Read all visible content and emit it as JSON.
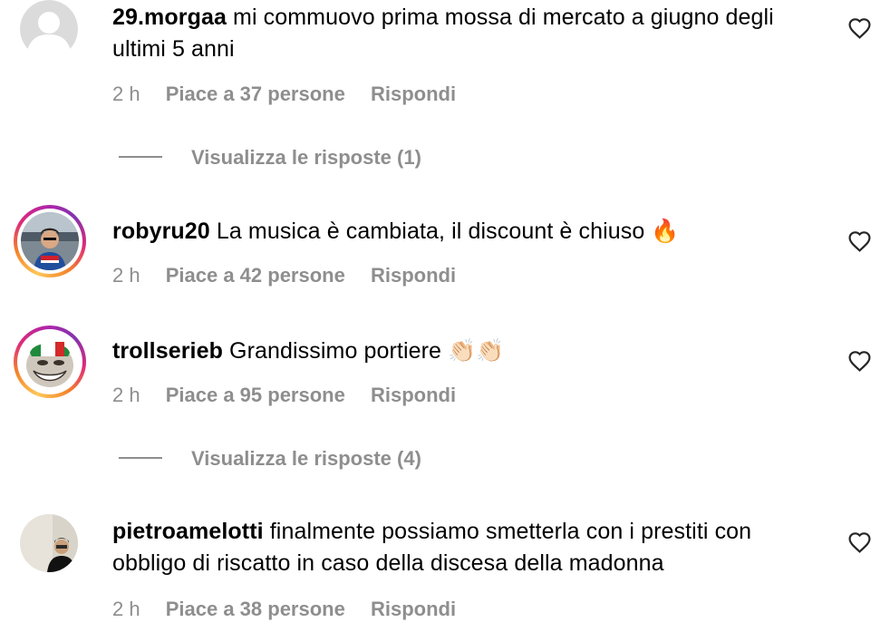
{
  "comments": [
    {
      "username": "29.morgaa",
      "text": "mi commuovo prima mossa di mercato a giugno degli ultimi 5 anni",
      "time": "2 h",
      "likes": "Piace a 37 persone",
      "reply": "Rispondi",
      "view_replies": "Visualizza le risposte (1)",
      "avatar": "default-avatar-icon"
    },
    {
      "username": "robyru20",
      "text": "La musica è cambiata, il discount è chiuso",
      "emoji": "🔥",
      "time": "2 h",
      "likes": "Piace a 42 persone",
      "reply": "Rispondi",
      "avatar": "user-photo-with-story-ring"
    },
    {
      "username": "trollserieb",
      "text": "Grandissimo portiere",
      "emoji": "👏🏻👏🏻",
      "time": "2 h",
      "likes": "Piace a 95 persone",
      "reply": "Rispondi",
      "view_replies": "Visualizza le risposte (4)",
      "avatar": "troll-face-with-story-ring"
    },
    {
      "username": "pietroamelotti",
      "text": "finalmente possiamo smetterla con i prestiti con obbligo di riscatto in caso della discesa della madonna",
      "time": "2 h",
      "likes": "Piace a 38 persone",
      "reply": "Rispondi",
      "avatar": "user-photo"
    }
  ],
  "icons": {
    "like": "heart-outline-icon"
  },
  "colors": {
    "text": "#000000",
    "muted": "#8e8e8e",
    "story_ring": [
      "#fdc75a",
      "#f58529",
      "#dd2a7b",
      "#8134af"
    ]
  }
}
